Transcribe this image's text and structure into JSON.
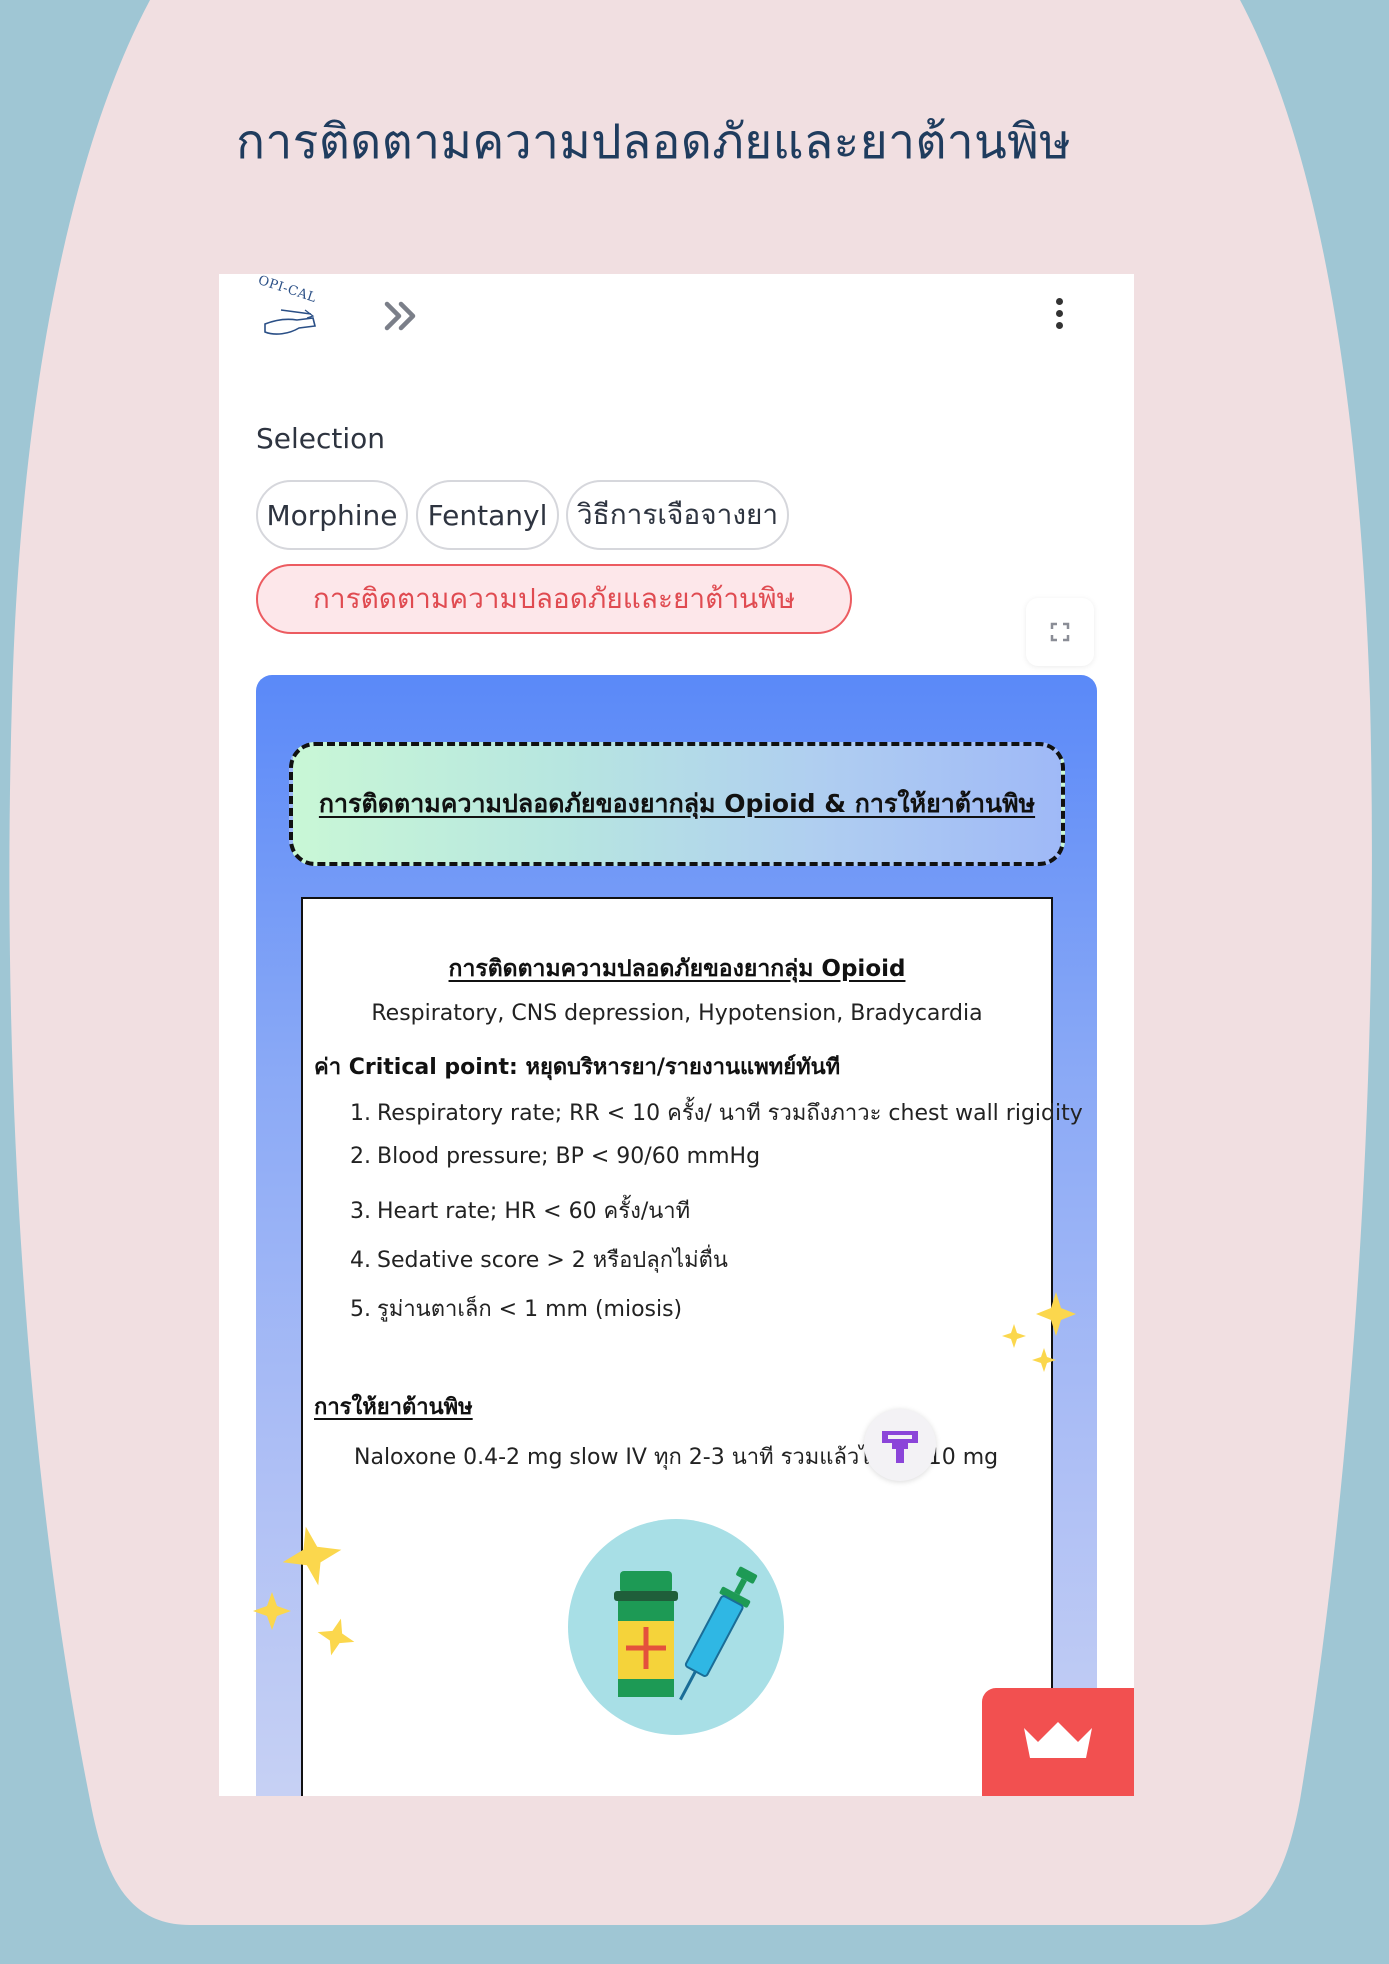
{
  "slide": {
    "title": "การติดตามความปลอดภัยและยาต้านพิษ"
  },
  "app": {
    "logo_text": "OPI-CAL",
    "expand_icon": "double-chevron-right-icon",
    "menu_icon": "kebab-menu-icon"
  },
  "selection": {
    "label": "Selection",
    "options": [
      "Morphine",
      "Fentanyl",
      "วิธีการเจือจางยา",
      "การติดตามความปลอดภัยและยาต้านพิษ"
    ],
    "active": "การติดตามความปลอดภัยและยาต้านพิษ"
  },
  "content": {
    "banner": "การติดตามความปลอดภัยของยากลุ่ม Opioid & การให้ยาต้านพิษ",
    "heading": "การติดตามความปลอดภัยของยากลุ่ม Opioid",
    "subheading": "Respiratory, CNS depression, Hypotension, Bradycardia",
    "critical_title": "ค่า Critical point: หยุดบริหารยา/รายงานแพทย์ทันที",
    "critical_items": [
      {
        "num": "1.",
        "text": "Respiratory rate; RR < 10 ครั้ง/ นาที รวมถึงภาวะ chest wall rigidity"
      },
      {
        "num": "2.",
        "text": "Blood pressure; BP < 90/60 mmHg"
      },
      {
        "num": "3.",
        "text": "Heart rate; HR < 60 ครั้ง/นาที"
      },
      {
        "num": "4.",
        "text": "Sedative score > 2 หรือปลุกไม่ตื่น"
      },
      {
        "num": "5.",
        "text": "รูม่านตาเล็ก < 1 mm (miosis)"
      }
    ],
    "antidote_title": "การให้ยาต้านพิษ",
    "antidote_text": "Naloxone 0.4-2 mg slow IV ทุก 2-3 นาที รวมแล้วไม่เกิน 10 mg"
  },
  "colors": {
    "page_bg": "#9fc6d4",
    "slide_bg": "#f1dfe1",
    "title": "#1f3c5e",
    "active_pill": "#e04b51",
    "crown_button": "#f25050"
  }
}
